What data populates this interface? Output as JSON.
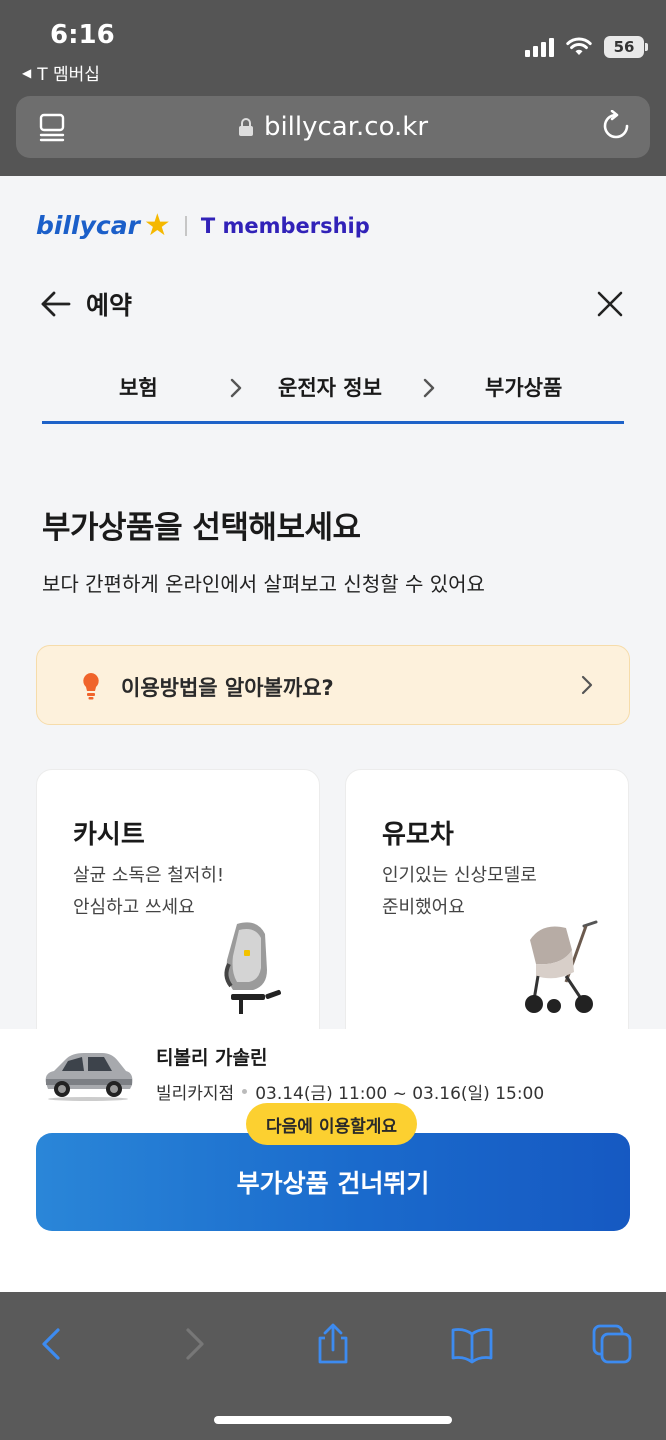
{
  "status_bar": {
    "time": "6:16",
    "back_app": "T 멤버십",
    "battery": "56"
  },
  "browser": {
    "url": "billycar.co.kr"
  },
  "brand": {
    "logo_main": "billycar",
    "logo_partner": "T membership",
    "primary_color": "#1e62c8",
    "star_color": "#f5b800"
  },
  "header": {
    "title": "예약"
  },
  "steps": [
    {
      "label": "보험"
    },
    {
      "label": "운전자 정보"
    },
    {
      "label": "부가상품"
    }
  ],
  "main": {
    "heading": "부가상품을 선택해보세요",
    "subheading": "보다 간편하게 온라인에서 살펴보고 신청할 수 있어요",
    "howto_label": "이용방법을 알아볼까요?"
  },
  "cards": [
    {
      "title": "카시트",
      "desc_line1": "살균 소독은 철저히!",
      "desc_line2": "안심하고 쓰세요",
      "icon": "car-seat"
    },
    {
      "title": "유모차",
      "desc_line1": "인기있는 신상모델로",
      "desc_line2": "준비했어요",
      "icon": "stroller"
    }
  ],
  "reservation": {
    "car_name": "티볼리 가솔린",
    "branch": "빌리카지점",
    "period": "03.14(금) 11:00 ~ 03.16(일) 15:00",
    "badge": "다음에 이용할게요",
    "skip_label": "부가상품 건너뛰기"
  }
}
